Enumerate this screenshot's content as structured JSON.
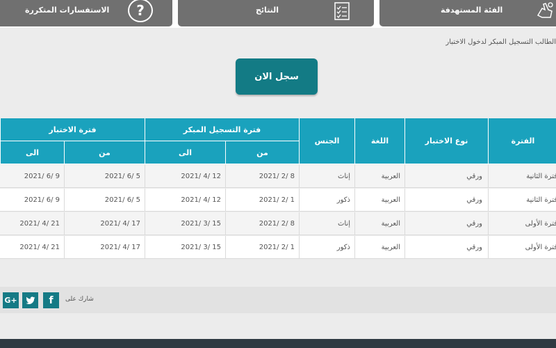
{
  "nav": {
    "faq_label": "الاستفسارات المتكررة",
    "faq_icon": "question-circle-icon",
    "results_label": "النتائج",
    "results_icon": "checklist-icon",
    "target_label": "الفئة المستهدفة",
    "target_icon": "hand-pointer-icon"
  },
  "intro_text": "الطالب التسجيل المبكر لدخول الاختبار",
  "register_button": "سجل الان",
  "table": {
    "headers": {
      "period": "الفترة",
      "exam_type": "نوع الاختبار",
      "language": "اللغة",
      "gender": "الجنس",
      "early_reg": "فترة التسجيل المبكر",
      "exam_period": "فترة الاختبار",
      "from": "من",
      "to": "الى"
    },
    "rows": [
      {
        "period": "فترة الثانية",
        "exam_type": "ورقي",
        "language": "العربية",
        "gender": "إناث",
        "reg_from": "2021/ 2/ 8",
        "reg_to": "2021/ 4/ 12",
        "exam_from": "2021/ 6/ 5",
        "exam_to": "2021/ 6/ 9"
      },
      {
        "period": "فترة الثانية",
        "exam_type": "ورقي",
        "language": "العربية",
        "gender": "ذكور",
        "reg_from": "2021/ 2/ 1",
        "reg_to": "2021/ 4/ 12",
        "exam_from": "2021/ 6/ 5",
        "exam_to": "2021/ 6/ 9"
      },
      {
        "period": "فترة الأولى",
        "exam_type": "ورقي",
        "language": "العربية",
        "gender": "إناث",
        "reg_from": "2021/ 2/ 8",
        "reg_to": "2021/ 3/ 15",
        "exam_from": "2021/ 4/ 17",
        "exam_to": "2021/ 4/ 21"
      },
      {
        "period": "فترة الأولى",
        "exam_type": "ورقي",
        "language": "العربية",
        "gender": "ذكور",
        "reg_from": "2021/ 2/ 1",
        "reg_to": "2021/ 3/ 15",
        "exam_from": "2021/ 4/ 17",
        "exam_to": "2021/ 4/ 21"
      }
    ]
  },
  "share": {
    "label": "شارك على",
    "facebook": "f",
    "twitter_icon": "twitter-bird-icon",
    "google": "G+"
  }
}
